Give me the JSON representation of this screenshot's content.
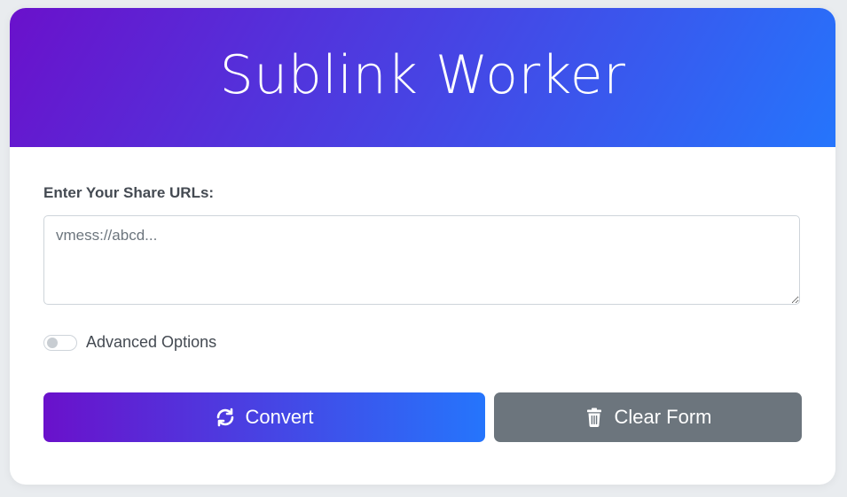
{
  "header": {
    "title": "Sublink Worker"
  },
  "form": {
    "urls_label": "Enter Your Share URLs:",
    "urls_placeholder": "vmess://abcd...",
    "urls_value": "",
    "advanced_label": "Advanced Options",
    "advanced_enabled": false
  },
  "actions": {
    "convert_label": "Convert",
    "convert_icon": "sync-icon",
    "clear_label": "Clear Form",
    "clear_icon": "trash-icon"
  },
  "colors": {
    "gradient_start": "#6a11cb",
    "gradient_end": "#2575fc",
    "secondary_button": "#6c757d"
  }
}
